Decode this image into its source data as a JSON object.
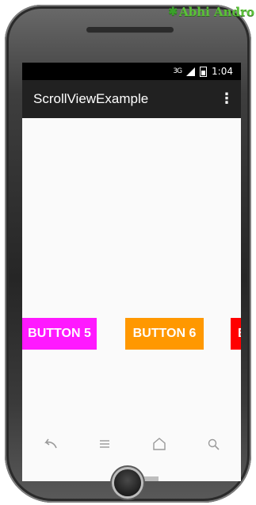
{
  "watermark": {
    "text": "Abhi Andro"
  },
  "statusbar": {
    "network": "3G",
    "time": "1:04"
  },
  "actionbar": {
    "title": "ScrollViewExample",
    "overflow_icon": "overflow-menu-icon"
  },
  "content": {
    "buttons": [
      {
        "label": "BUTTON 5",
        "color": "#ff19ff"
      },
      {
        "label": "BUTTON 6",
        "color": "#ff9800"
      },
      {
        "label": "B",
        "color": "#ff0000"
      }
    ]
  },
  "navbar": {
    "icons": [
      "back-icon",
      "menu-icon",
      "home-icon",
      "search-icon"
    ]
  },
  "colors": {
    "actionbar": "#212121",
    "statusbar": "#000000",
    "screen_bg": "#fafafa"
  }
}
